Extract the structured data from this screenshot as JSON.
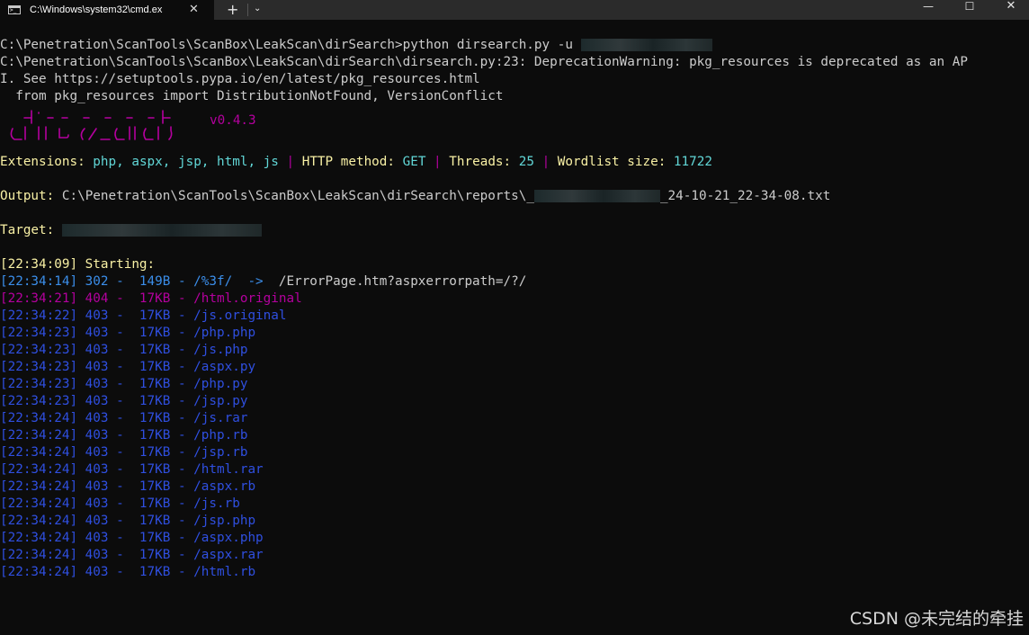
{
  "window": {
    "tab_title": "C:\\Windows\\system32\\cmd.ex",
    "tab_close": "✕",
    "new_tab": "+",
    "dropdown": "⌄",
    "minimize": "—",
    "maximize": "☐",
    "close": "✕"
  },
  "colors": {
    "background": "#0c0c0c",
    "default_text": "#cccccc",
    "yellow": "#f9f1a5",
    "cyan": "#61d6d6",
    "magenta": "#b4009e",
    "light_blue": "#3b8eea",
    "blue": "#2f4fe0"
  },
  "terminal": {
    "command": "C:\\Penetration\\ScanTools\\ScanBox\\LeakScan\\dirSearch>python dirsearch.py -u ",
    "warning_line1": "C:\\Penetration\\ScanTools\\ScanBox\\LeakScan\\dirSearch\\dirsearch.py:23: DeprecationWarning: pkg_resources is deprecated as an AP",
    "warning_line2": "I. See https://setuptools.pypa.io/en/latest/pkg_resources.html",
    "warning_line3": "  from pkg_resources import DistributionNotFound, VersionConflict",
    "version": "v0.4.3",
    "config": {
      "ext_label": "Extensions: ",
      "ext_value": "php, aspx, jsp, html, js",
      "sep": " | ",
      "method_label": "HTTP method: ",
      "method_value": "GET",
      "threads_label": "Threads: ",
      "threads_value": "25",
      "wordlist_label": "Wordlist size: ",
      "wordlist_value": "11722"
    },
    "output_label": "Output: ",
    "output_path_prefix": "C:\\Penetration\\ScanTools\\ScanBox\\LeakScan\\dirSearch\\reports\\_",
    "output_path_suffix": "_24-10-21_22-34-08.txt",
    "target_label": "Target: ",
    "starting": "[22:34:09] Starting:",
    "results": [
      {
        "time": "[22:34:14]",
        "status": "302",
        "size": "149B",
        "path": "/%3f/",
        "redirect": "/ErrorPage.htm?aspxerrorpath=/?/",
        "color": "lb"
      },
      {
        "time": "[22:34:21]",
        "status": "404",
        "size": "17KB",
        "path": "/html.original",
        "color": "m"
      },
      {
        "time": "[22:34:22]",
        "status": "403",
        "size": "17KB",
        "path": "/js.original",
        "color": "db"
      },
      {
        "time": "[22:34:23]",
        "status": "403",
        "size": "17KB",
        "path": "/php.php",
        "color": "db"
      },
      {
        "time": "[22:34:23]",
        "status": "403",
        "size": "17KB",
        "path": "/js.php",
        "color": "db"
      },
      {
        "time": "[22:34:23]",
        "status": "403",
        "size": "17KB",
        "path": "/aspx.py",
        "color": "db"
      },
      {
        "time": "[22:34:23]",
        "status": "403",
        "size": "17KB",
        "path": "/php.py",
        "color": "db"
      },
      {
        "time": "[22:34:23]",
        "status": "403",
        "size": "17KB",
        "path": "/jsp.py",
        "color": "db"
      },
      {
        "time": "[22:34:24]",
        "status": "403",
        "size": "17KB",
        "path": "/js.rar",
        "color": "db"
      },
      {
        "time": "[22:34:24]",
        "status": "403",
        "size": "17KB",
        "path": "/php.rb",
        "color": "db"
      },
      {
        "time": "[22:34:24]",
        "status": "403",
        "size": "17KB",
        "path": "/jsp.rb",
        "color": "db"
      },
      {
        "time": "[22:34:24]",
        "status": "403",
        "size": "17KB",
        "path": "/html.rar",
        "color": "db"
      },
      {
        "time": "[22:34:24]",
        "status": "403",
        "size": "17KB",
        "path": "/aspx.rb",
        "color": "db"
      },
      {
        "time": "[22:34:24]",
        "status": "403",
        "size": "17KB",
        "path": "/js.rb",
        "color": "db"
      },
      {
        "time": "[22:34:24]",
        "status": "403",
        "size": "17KB",
        "path": "/jsp.php",
        "color": "db"
      },
      {
        "time": "[22:34:24]",
        "status": "403",
        "size": "17KB",
        "path": "/aspx.php",
        "color": "db"
      },
      {
        "time": "[22:34:24]",
        "status": "403",
        "size": "17KB",
        "path": "/aspx.rar",
        "color": "db"
      },
      {
        "time": "[22:34:24]",
        "status": "403",
        "size": "17KB",
        "path": "/html.rb",
        "color": "db"
      }
    ]
  },
  "watermark": "CSDN @未完结的牵挂"
}
